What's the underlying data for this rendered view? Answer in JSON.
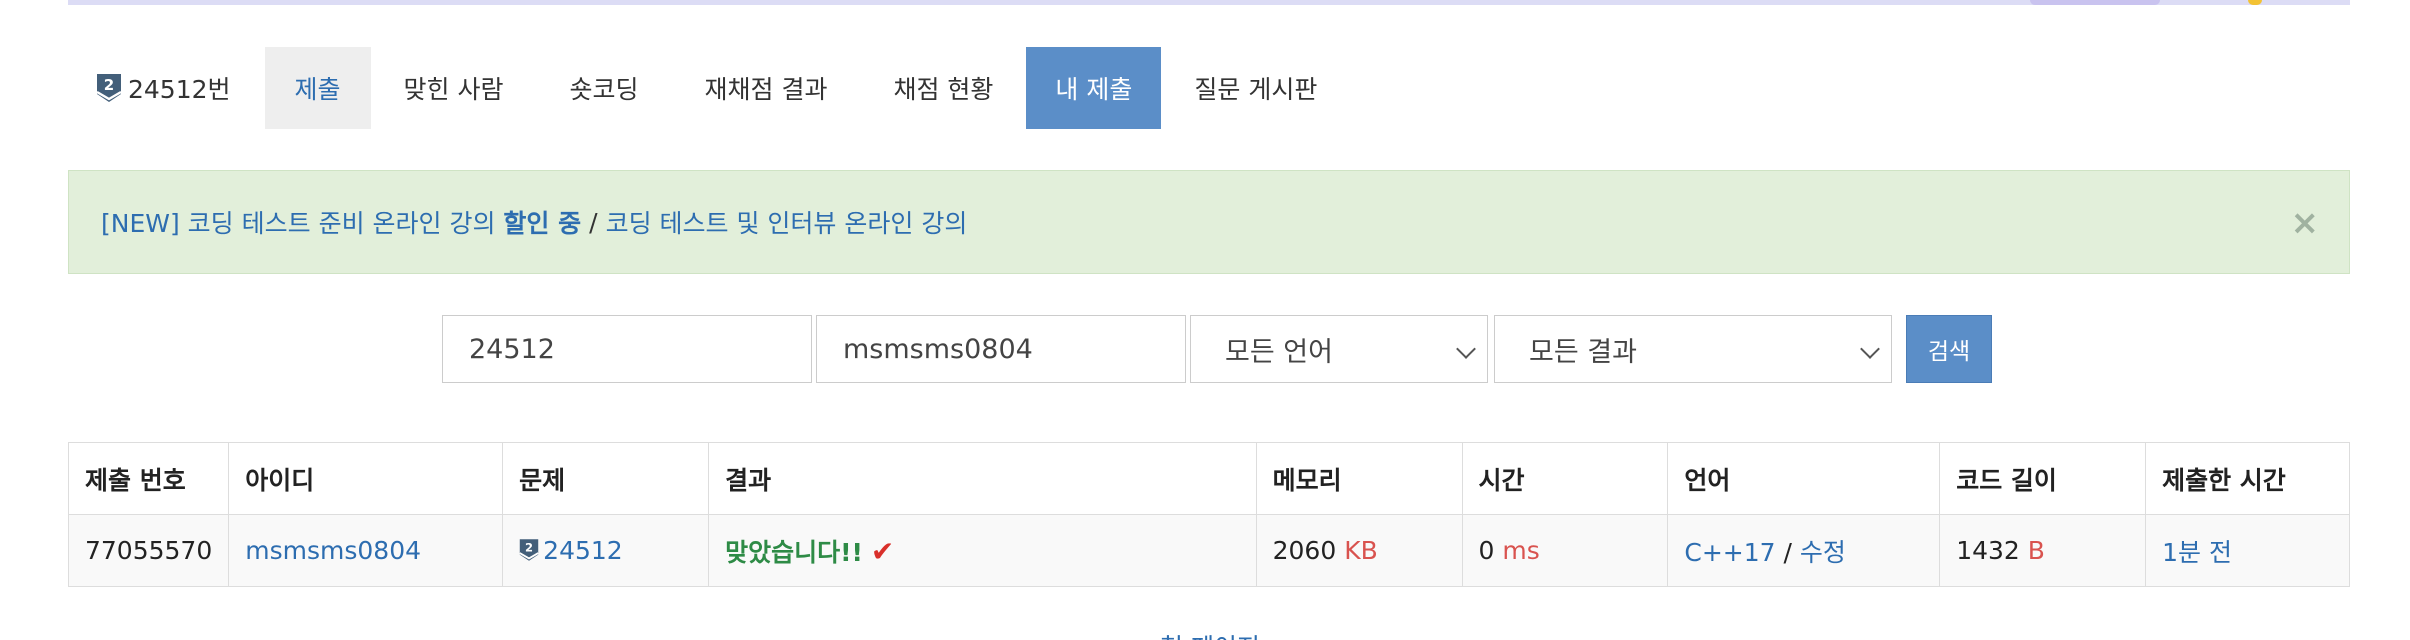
{
  "tabs": {
    "problem_label": "24512번",
    "submit": "제출",
    "solved_users": "맞힌 사람",
    "short_coding": "숏코딩",
    "rejudge_results": "재채점 결과",
    "judge_status": "채점 현황",
    "my_submissions": "내 제출",
    "qna_board": "질문 게시판"
  },
  "tier": {
    "number": "2",
    "color": "#435f7a"
  },
  "alert": {
    "new_prefix": "[NEW] 코딩 테스트 준비 온라인 강의",
    "discount": "할인 중",
    "separator": "/",
    "second_link": "코딩 테스트 및 인터뷰 온라인 강의",
    "close": "×"
  },
  "search": {
    "problem_id": "24512",
    "user_id": "msmsms0804",
    "language": "모든 언어",
    "result": "모든 결과",
    "button": "검색"
  },
  "table": {
    "headers": [
      "제출 번호",
      "아이디",
      "문제",
      "결과",
      "메모리",
      "시간",
      "언어",
      "코드 길이",
      "제출한 시간"
    ],
    "row": {
      "submission_id": "77055570",
      "user": "msmsms0804",
      "problem": "24512",
      "result": "맞았습니다!!",
      "check": "✔",
      "memory": "2060",
      "memory_unit": "KB",
      "time": "0",
      "time_unit": "ms",
      "language": "C++17",
      "lang_sep": "/",
      "edit": "수정",
      "code_length": "1432",
      "code_unit": "B",
      "submitted": "1분 전"
    }
  },
  "pagination": {
    "first_page": "첫 페이지"
  },
  "colors": {
    "accent": "#5b8ec8",
    "link": "#2d6db0",
    "success": "#2e8b46",
    "alert_bg": "#e2efda",
    "unit": "#d9534f"
  }
}
